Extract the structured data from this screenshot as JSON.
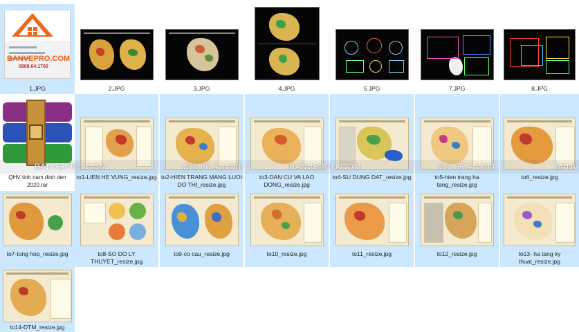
{
  "window": {
    "view": "large-icons",
    "accent_selection": "#cce8ff"
  },
  "files": [
    {
      "label": "1.JPG",
      "icon": "logo-image",
      "selected": true
    },
    {
      "label": "2.JPG",
      "icon": "dark-map-image",
      "selected": false
    },
    {
      "label": "3.JPG",
      "icon": "dark-map-image",
      "selected": false
    },
    {
      "label": "4.JPG",
      "icon": "dark-map-image",
      "selected": false
    },
    {
      "label": "5.JPG",
      "icon": "cad-drawing-image",
      "selected": false
    },
    {
      "label": "7.JPG",
      "icon": "cad-drawing-image",
      "selected": false
    },
    {
      "label": "8.JPG",
      "icon": "cad-drawing-image",
      "selected": false
    },
    {
      "label": "QHV tinh nam dinh den 2020.rar",
      "icon": "winrar-archive",
      "selected": false
    },
    {
      "label": "to1-LIEN HE VUNG_resize.jpg",
      "icon": "map-image",
      "selected": true
    },
    {
      "label": "to2-HIEN TRANG MANG LUOI DO THI_resize.jpg",
      "icon": "map-image",
      "selected": true
    },
    {
      "label": "to3-DAN CU VA LAO DONG_resize.jpg",
      "icon": "map-image",
      "selected": true
    },
    {
      "label": "to4-SU DUNG DAT_resize.jpg",
      "icon": "map-image",
      "selected": true
    },
    {
      "label": "to5-hien trang ha tang_resize.jpg",
      "icon": "map-image",
      "selected": true
    },
    {
      "label": "to6_resize.jpg",
      "icon": "map-image",
      "selected": true
    },
    {
      "label": "to7-tong hop_resize.jpg",
      "icon": "map-image",
      "selected": true
    },
    {
      "label": "to8-SO DO LY THUYET_resize.jpg",
      "icon": "map-image",
      "selected": true
    },
    {
      "label": "to9-co cau_resize.jpg",
      "icon": "map-image",
      "selected": true
    },
    {
      "label": "to10_resize.jpg",
      "icon": "map-image",
      "selected": true
    },
    {
      "label": "to11_resize.jpg",
      "icon": "map-image",
      "selected": true
    },
    {
      "label": "to12_resize.jpg",
      "icon": "map-image",
      "selected": true
    },
    {
      "label": "to13- ha tang ky thuat_resize.jpg",
      "icon": "map-image",
      "selected": true
    },
    {
      "label": "to14-DTM_resize.jpg",
      "icon": "map-image",
      "selected": true
    }
  ],
  "logo": {
    "brand": "BANVEPRO.COM",
    "phone": "0868.64.1760"
  },
  "watermark": {
    "brand": "BANVEPRO.COM",
    "phone": "086.86.4.1760",
    "trail": "BANV"
  }
}
